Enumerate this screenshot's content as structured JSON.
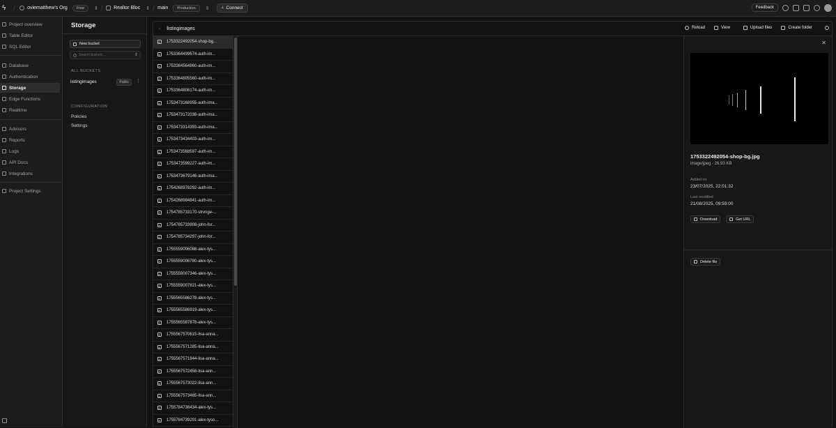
{
  "topbar": {
    "org": "oviematthew's Org",
    "org_plan": "Free",
    "project": "Realtor Bloc",
    "branch": "main",
    "branch_env": "Production",
    "connect": "Connect",
    "feedback": "Feedback",
    "icons": [
      "help-icon",
      "inbox-icon",
      "terminal-icon",
      "settings-icon",
      "avatar"
    ]
  },
  "nav": {
    "items": [
      {
        "label": "Project overview",
        "icon": "home-icon"
      },
      {
        "label": "Table Editor",
        "icon": "table-icon"
      },
      {
        "label": "SQL Editor",
        "icon": "terminal-icon"
      },
      {
        "label": "Database",
        "icon": "database-icon"
      },
      {
        "label": "Authentication",
        "icon": "users-icon"
      },
      {
        "label": "Storage",
        "icon": "storage-icon",
        "active": true
      },
      {
        "label": "Edge Functions",
        "icon": "functions-icon"
      },
      {
        "label": "Realtime",
        "icon": "realtime-icon"
      },
      {
        "label": "Advisors",
        "icon": "lightbulb-icon"
      },
      {
        "label": "Reports",
        "icon": "chart-icon"
      },
      {
        "label": "Logs",
        "icon": "list-icon"
      },
      {
        "label": "API Docs",
        "icon": "doc-icon"
      },
      {
        "label": "Integrations",
        "icon": "puzzle-icon"
      },
      {
        "label": "Project Settings",
        "icon": "gear-icon"
      }
    ]
  },
  "storage_menu": {
    "title": "Storage",
    "new_bucket": "New bucket",
    "search_placeholder": "Search buckets...",
    "all_buckets_label": "ALL BUCKETS",
    "bucket_name": "listingimages",
    "bucket_badge": "Public",
    "configuration_label": "CONFIGURATION",
    "policies": "Policies",
    "settings": "Settings"
  },
  "explorer": {
    "path": "listingimages",
    "actions": {
      "reload": "Reload",
      "view": "View",
      "upload": "Upload files",
      "create_folder": "Create folder"
    },
    "files": [
      "1753322492054-shop-bg...",
      "1753364499674-auth-im...",
      "1753364564860-auth-im...",
      "1753364805560-auth-im...",
      "1753364806174-auth-im...",
      "1753473168955-auth-ima...",
      "1753473172038-auth-ima...",
      "1753473314393-auth-ima...",
      "1753473434403-auth-im...",
      "1753473568597-auth-im...",
      "1753473599227-auth-im...",
      "1753473679146-auth-ima...",
      "1754268978292-auth-im...",
      "1754268984841-auth-im...",
      "1754785733170-strvnge-...",
      "1754785733908-john-for...",
      "1754785734297-john-for...",
      "1755559006088-alex-tys...",
      "1755559006780-alex-tys...",
      "1755559007346-alex-tys...",
      "1755559007821-alex-tys...",
      "1755565586278-alex-tys...",
      "1755565586919-alex-tys...",
      "1755565587878-alex-tys...",
      "1755567570615-lisa-anna...",
      "1755567571285-lisa-anna...",
      "1755567571844-lisa-anna...",
      "1755567572458-lisa-ann...",
      "1755567573022-lisa-ann...",
      "1755567573465-lisa-ann...",
      "1755784738434-alex-tys...",
      "1755784739201-alex-tyso..."
    ],
    "selected_index": 0
  },
  "preview": {
    "file_name": "1753322492054-shop-bg.jpg",
    "meta": "image/jpeg - 26.93 KB",
    "added_label": "Added on",
    "added_value": "23/07/2025, 22:01:32",
    "modified_label": "Last modified",
    "modified_value": "21/08/2025, 09:59:00",
    "download": "Download",
    "get_url": "Get URL",
    "delete": "Delete file"
  },
  "colors": {
    "background": "#121212",
    "panel": "#1c1c1c",
    "border": "#2e2e2e",
    "text": "#ededed",
    "muted": "#8a8a8a"
  }
}
